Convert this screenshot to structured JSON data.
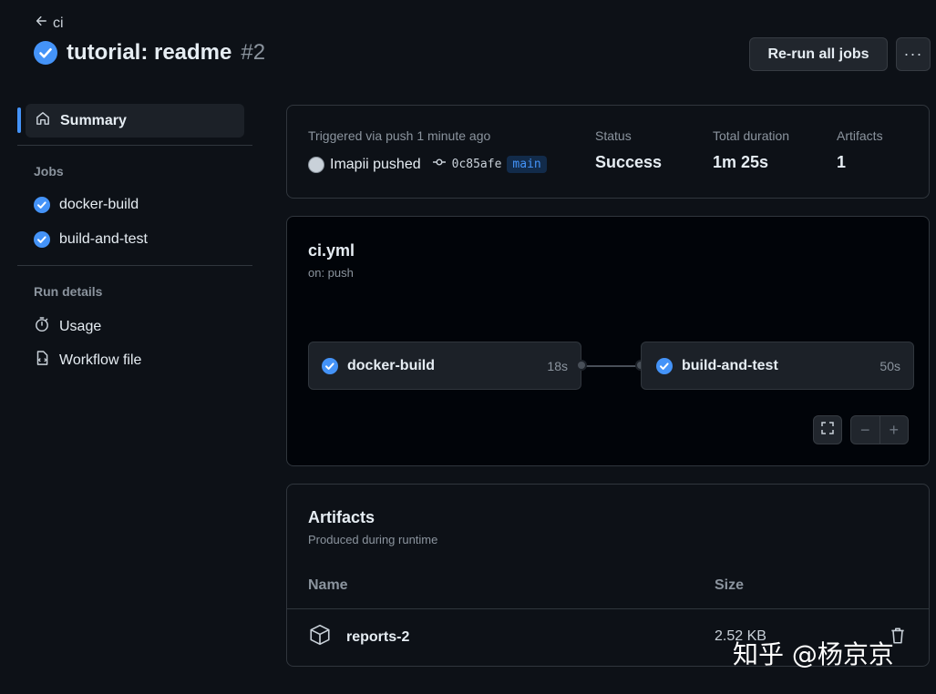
{
  "header": {
    "back_label": "ci",
    "title": "tutorial: readme",
    "run_number": "#2",
    "rerun_label": "Re-run all jobs",
    "more_label": "···"
  },
  "sidebar": {
    "summary_label": "Summary",
    "jobs_heading": "Jobs",
    "jobs": [
      {
        "label": "docker-build"
      },
      {
        "label": "build-and-test"
      }
    ],
    "run_details_heading": "Run details",
    "details": [
      {
        "label": "Usage",
        "icon": "stopwatch-icon"
      },
      {
        "label": "Workflow file",
        "icon": "file-code-icon"
      }
    ]
  },
  "run_info": {
    "triggered_text": "Triggered via push 1 minute ago",
    "actor": "Imapii pushed",
    "commit": "0c85afe",
    "branch": "main",
    "status_label": "Status",
    "status_value": "Success",
    "duration_label": "Total duration",
    "duration_value": "1m 25s",
    "artifacts_label": "Artifacts",
    "artifacts_value": "1"
  },
  "workflow": {
    "file": "ci.yml",
    "trigger": "on: push",
    "jobs": [
      {
        "name": "docker-build",
        "duration": "18s"
      },
      {
        "name": "build-and-test",
        "duration": "50s"
      }
    ],
    "zoom_out": "−",
    "zoom_in": "+"
  },
  "artifacts": {
    "title": "Artifacts",
    "subtitle": "Produced during runtime",
    "col_name": "Name",
    "col_size": "Size",
    "rows": [
      {
        "name": "reports-2",
        "size": "2.52 KB"
      }
    ]
  },
  "watermark": "知乎 @杨京京",
  "colors": {
    "background": "#0d1117",
    "accent": "#4493f8",
    "border": "#30363d"
  }
}
